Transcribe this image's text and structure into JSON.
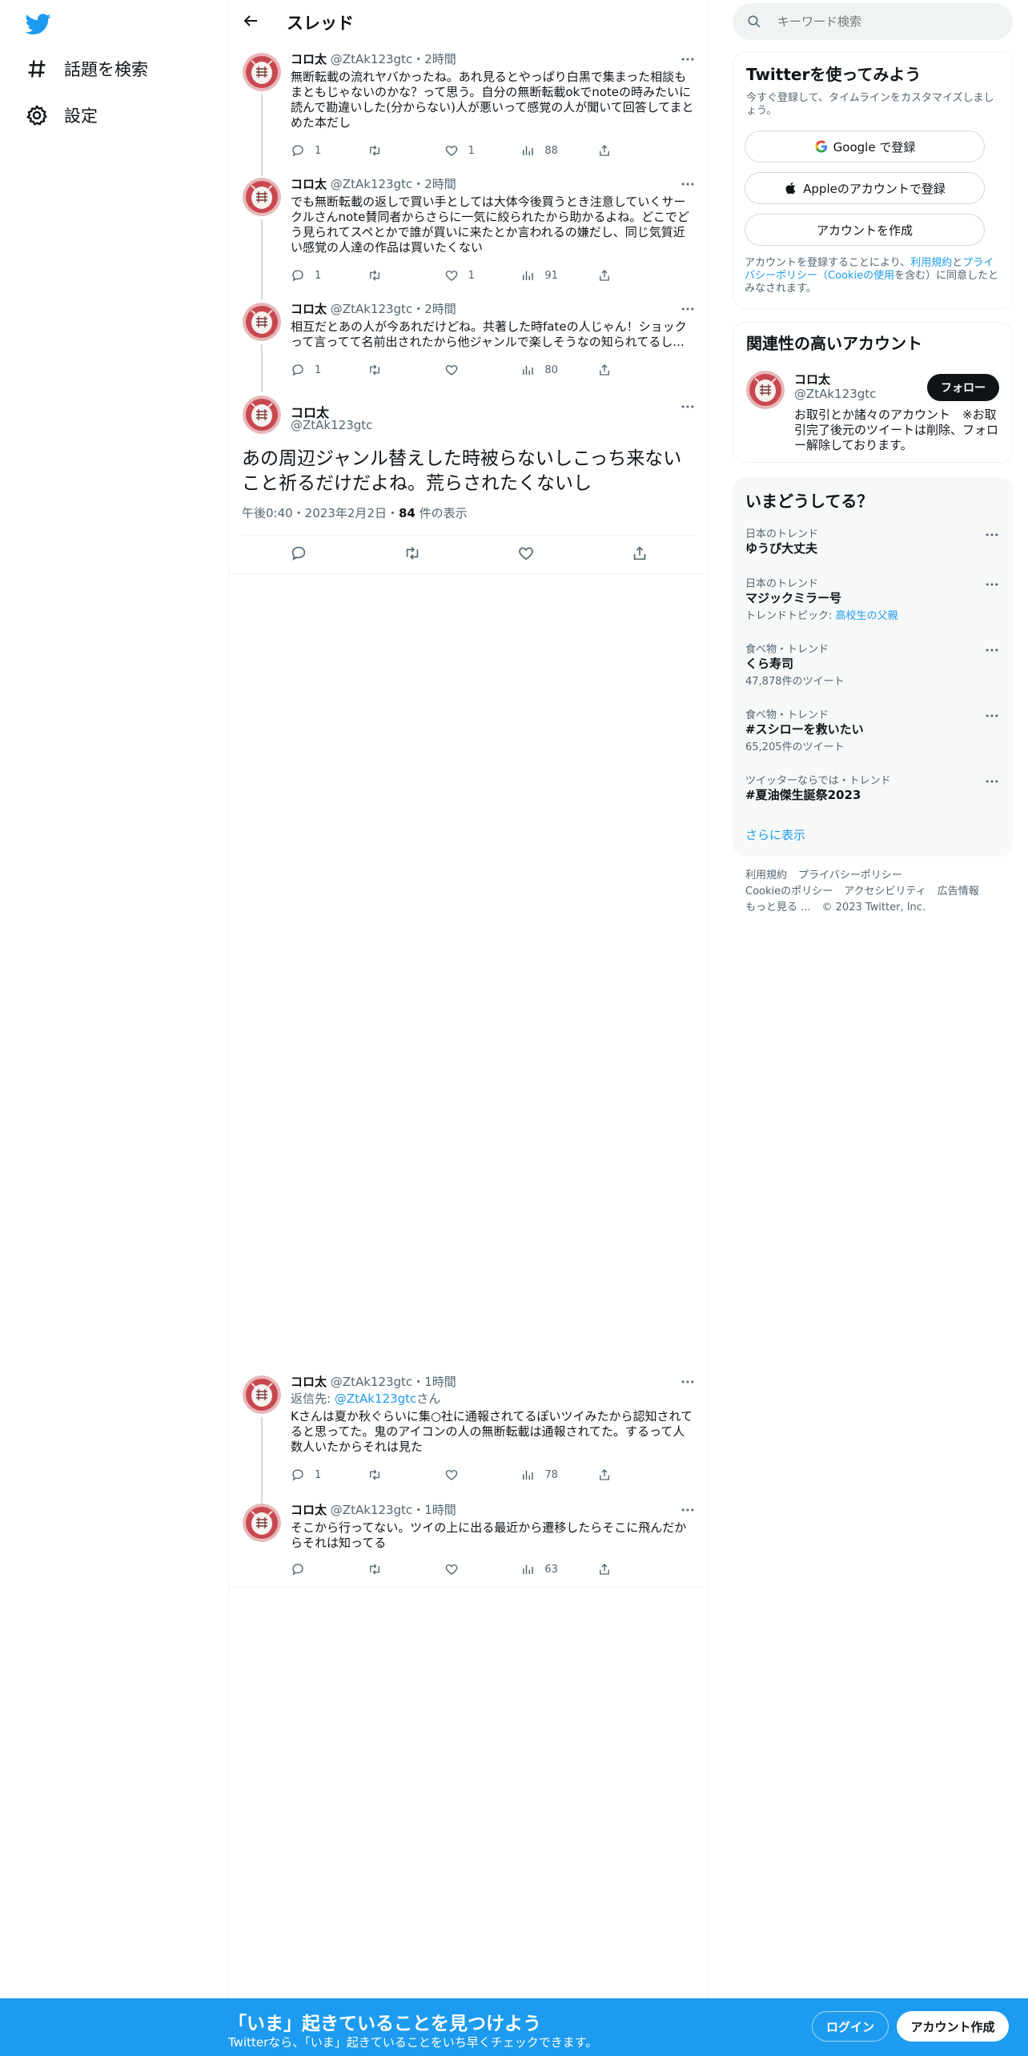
{
  "nav": {
    "explore_label": "話題を検索",
    "settings_label": "設定"
  },
  "header": {
    "title": "スレッド"
  },
  "author": {
    "name": "コロ太",
    "handle": "@ZtAk123gtc"
  },
  "replies_before": [
    {
      "time": "2時間",
      "text": "無断転載の流れヤバかったね。あれ見るとやっぱり白黒で集まった相談もまともじゃないのかな？って思う。自分の無断転載okでnoteの時みたいに読んで勘違いした(分からない)人が悪いって感覚の人が聞いて回答してまとめた本だし",
      "replies": "1",
      "retweets": "",
      "likes": "1",
      "views": "88"
    },
    {
      "time": "2時間",
      "text": "でも無断転載の返しで買い手としては大体今後買うとき注意していくサークルさんnote賛同者からさらに一気に絞られたから助かるよね。どこでどう見られてスペとかで誰が買いに来たとか言われるの嫌だし、同じ気質近い感覚の人達の作品は買いたくない",
      "replies": "1",
      "retweets": "",
      "likes": "1",
      "views": "91"
    },
    {
      "time": "2時間",
      "text": "相互だとあの人が今あれだけどね。共著した時fateの人じゃん！ショックって言ってて名前出されたから他ジャンルで楽しそうなの知られてるし...",
      "replies": "1",
      "retweets": "",
      "likes": "",
      "views": "80"
    }
  ],
  "main_tweet": {
    "text": "あの周辺ジャンル替えした時被らないしこっち来ないこと祈るだけだよね。荒らされたくないし",
    "date": "午後0:40・2023年2月2日・",
    "views_count": "84",
    "views_suffix": " 件の表示"
  },
  "replies_after": [
    {
      "time": "1時間",
      "reply_prefix": "返信先: ",
      "reply_link": "@ZtAk123gtc",
      "reply_suffix": "さん",
      "text": "Kさんは夏か秋ぐらいに集○社に通報されてるぽいツイみたから認知されてると思ってた。鬼のアイコンの人の無断転載は通報されてた。するって人数人いたからそれは見た",
      "replies": "1",
      "retweets": "",
      "likes": "",
      "views": "78"
    },
    {
      "time": "1時間",
      "text": "そこから行ってない。ツイの上に出る最近から遷移したらそこに飛んだからそれは知ってる",
      "replies": "",
      "retweets": "",
      "likes": "",
      "views": "63"
    }
  ],
  "search": {
    "placeholder": "キーワード検索"
  },
  "signup_panel": {
    "title": "Twitterを使ってみよう",
    "subtitle": "今すぐ登録して、タイムラインをカスタマイズしましょう。",
    "google_label": "Google で登録",
    "apple_label": "Appleのアカウントで登録",
    "create_label": "アカウントを作成",
    "terms_prefix": "アカウントを登録することにより、",
    "terms_link1": "利用規約",
    "terms_mid": "と",
    "terms_link2": "プライバシーポリシー（Cookieの使用",
    "terms_suffix": "を含む）に同意したとみなされます。"
  },
  "relevant_panel": {
    "title": "関連性の高いアカウント",
    "follow_label": "フォロー",
    "bio": "お取引とか諸々のアカウント　※お取引完了後元のツイートは削除、フォロー解除しております。"
  },
  "trends_panel": {
    "title": "いまどうしてる？",
    "items": [
      {
        "context": "日本のトレンド",
        "name": "ゆうぴ大丈夫",
        "sub_prefix": "",
        "sub_link": "",
        "sub": ""
      },
      {
        "context": "日本のトレンド",
        "name": "マジックミラー号",
        "sub_prefix": "トレンドトピック: ",
        "sub_link": "高校生の父親",
        "sub": ""
      },
      {
        "context": "食べ物・トレンド",
        "name": "くら寿司",
        "sub_prefix": "",
        "sub_link": "",
        "sub": "47,878件のツイート"
      },
      {
        "context": "食べ物・トレンド",
        "name": "#スシローを救いたい",
        "sub_prefix": "",
        "sub_link": "",
        "sub": "65,205件のツイート"
      },
      {
        "context": "ツイッターならでは・トレンド",
        "name": "#夏油傑生誕祭2023",
        "sub_prefix": "",
        "sub_link": "",
        "sub": ""
      }
    ],
    "show_more": "さらに表示"
  },
  "footer": {
    "terms": "利用規約",
    "privacy": "プライバシーポリシー",
    "cookie": "Cookieのポリシー",
    "accessibility": "アクセシビリティ",
    "ads": "広告情報",
    "more": "もっと見る ...",
    "copyright": "© 2023 Twitter, Inc."
  },
  "bottom_bar": {
    "title": "「いま」起きていることを見つけよう",
    "subtitle": "Twitterなら、「いま」起きていることをいち早くチェックできます。",
    "login_label": "ログイン",
    "signup_label": "アカウント作成"
  },
  "colors": {
    "accent": "#1d9bf0",
    "text": "#0f1419",
    "muted": "#536471",
    "border": "#eff3f4"
  },
  "icons": [
    "twitter-logo-icon",
    "hashtag-icon",
    "gear-icon",
    "back-arrow-icon",
    "more-icon",
    "reply-icon",
    "retweet-icon",
    "like-icon",
    "views-icon",
    "share-icon",
    "search-icon",
    "google-icon",
    "apple-icon"
  ]
}
